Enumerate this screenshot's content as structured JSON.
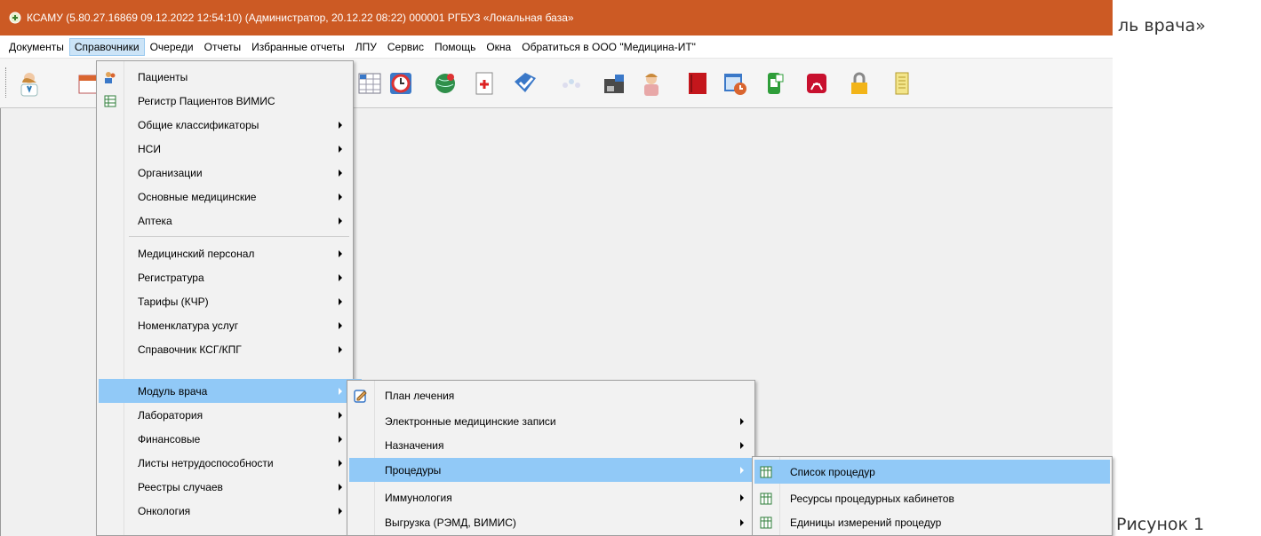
{
  "titlebar": {
    "text": "КСАМУ (5.80.27.16869 09.12.2022 12:54:10) (Администратор, 20.12.22 08:22) 000001 РГБУЗ «Локальная база»"
  },
  "document": {
    "tail_text": "ль врача»",
    "caption": "Рисунок 1"
  },
  "menubar": {
    "items": [
      "Документы",
      "Справочники",
      "Очереди",
      "Отчеты",
      "Избранные отчеты",
      "ЛПУ",
      "Сервис",
      "Помощь",
      "Окна",
      "Обратиться в ООО \"Медицина-ИТ\""
    ],
    "active_index": 1
  },
  "toolbar": {
    "icons": [
      "doctor-icon",
      "calendar-icon",
      "schedule-grid-icon",
      "clock-icon",
      "globe-icon",
      "medical-card-icon",
      "shield-check-icon",
      "dots-icon",
      "printer-icon",
      "nurse-icon",
      "book-red-icon",
      "calendar-clock-icon",
      "phone-icon",
      "acrobat-icon",
      "lock-icon",
      "scroll-icon"
    ]
  },
  "menus": {
    "main": {
      "items": [
        {
          "label": "Пациенты",
          "icon": "patients-icon",
          "submenu": false
        },
        {
          "label": "Регистр Пациентов ВИМИС",
          "icon": "table-icon",
          "submenu": false
        },
        {
          "label": "Общие классификаторы",
          "submenu": true
        },
        {
          "label": "НСИ",
          "submenu": true
        },
        {
          "label": "Организации",
          "submenu": true
        },
        {
          "label": "Основные медицинские",
          "submenu": true
        },
        {
          "label": "Аптека",
          "submenu": true
        },
        {
          "label": "Медицинский персонал",
          "submenu": true
        },
        {
          "label": "Регистратура",
          "submenu": true
        },
        {
          "label": "Тарифы (КЧР)",
          "submenu": true
        },
        {
          "label": "Номенклатура услуг",
          "submenu": true
        },
        {
          "label": "Справочник КСГ/КПГ",
          "submenu": true
        },
        {
          "label": "Модуль врача",
          "submenu": true,
          "highlighted": true
        },
        {
          "label": "Лаборатория",
          "submenu": true
        },
        {
          "label": "Финансовые",
          "submenu": true
        },
        {
          "label": "Листы нетрудоспособности",
          "submenu": true
        },
        {
          "label": "Реестры случаев",
          "submenu": true
        },
        {
          "label": "Онкология",
          "submenu": true
        }
      ]
    },
    "doctor_module": {
      "items": [
        {
          "label": "План лечения",
          "icon": "treatment-plan-icon",
          "submenu": false
        },
        {
          "label": "Электронные медицинские записи",
          "submenu": true
        },
        {
          "label": "Назначения",
          "submenu": true
        },
        {
          "label": "Процедуры",
          "submenu": true,
          "highlighted": true
        },
        {
          "label": "Иммунология",
          "submenu": true
        },
        {
          "label": "Выгрузка (РЭМД, ВИМИС)",
          "submenu": true
        }
      ]
    },
    "procedures": {
      "items": [
        {
          "label": "Список процедур",
          "icon": "table-icon",
          "highlighted": true
        },
        {
          "label": "Ресурсы процедурных кабинетов",
          "icon": "table-icon"
        },
        {
          "label": "Единицы измерений процедур",
          "icon": "table-icon"
        }
      ]
    }
  },
  "colors": {
    "titlebar": "#cc5a24",
    "menu_highlight": "#91c9f7",
    "menubar_active": "#cce4f7"
  }
}
